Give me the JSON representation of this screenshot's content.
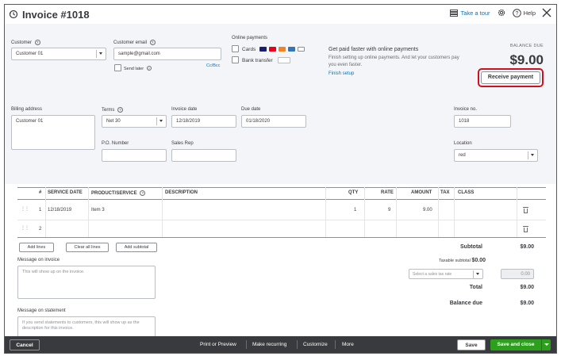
{
  "header": {
    "title": "Invoice #1018",
    "take_tour": "Take a tour",
    "help": "Help"
  },
  "customer": {
    "label": "Customer",
    "value": "Customer 01",
    "email_label": "Customer email",
    "email_value": "sample@gmail.com",
    "send_later": "Send later",
    "cc_bcc": "Cc/Bcc"
  },
  "online_payments": {
    "label": "Online payments",
    "cards": "Cards",
    "bank_transfer": "Bank transfer"
  },
  "promo": {
    "title": "Get paid faster with online payments",
    "body": "Finish setting up online payments. And let your customers pay you even faster.",
    "link": "Finish setup"
  },
  "balance": {
    "label": "BALANCE DUE",
    "amount": "$9.00",
    "receive_payment": "Receive payment"
  },
  "billing": {
    "address_label": "Billing address",
    "address_value": "Customer 01",
    "terms_label": "Terms",
    "terms_value": "Net 30",
    "invoice_date_label": "Invoice date",
    "invoice_date_value": "12/18/2019",
    "due_date_label": "Due date",
    "due_date_value": "01/18/2020",
    "invoice_no_label": "Invoice no.",
    "invoice_no_value": "1018",
    "po_label": "P.O. Number",
    "sales_rep_label": "Sales Rep",
    "location_label": "Location",
    "location_value": "red"
  },
  "table": {
    "headers": {
      "num": "#",
      "service_date": "SERVICE DATE",
      "product": "PRODUCT/SERVICE",
      "description": "DESCRIPTION",
      "qty": "QTY",
      "rate": "RATE",
      "amount": "AMOUNT",
      "tax": "TAX",
      "class": "CLASS"
    },
    "rows": [
      {
        "num": "1",
        "service_date": "12/18/2019",
        "product": "Item 3",
        "description": "",
        "qty": "1",
        "rate": "9",
        "amount": "9.00"
      },
      {
        "num": "2",
        "service_date": "",
        "product": "",
        "description": "",
        "qty": "",
        "rate": "",
        "amount": ""
      }
    ],
    "add_lines": "Add lines",
    "clear_all_lines": "Clear all lines",
    "add_subtotal": "Add subtotal"
  },
  "messages": {
    "invoice_label": "Message on invoice",
    "invoice_placeholder": "This will show up on the invoice.",
    "statement_label": "Message on statement",
    "statement_placeholder": "If you send statements to customers, this will show up as the description for this invoice."
  },
  "totals": {
    "subtotal_label": "Subtotal",
    "subtotal_value": "$9.00",
    "taxable_label": "Taxable subtotal",
    "taxable_value": "$0.00",
    "tax_rate_placeholder": "Select a sales tax rate",
    "tax_value": "0.00",
    "total_label": "Total",
    "total_value": "$9.00",
    "balance_due_label": "Balance due",
    "balance_due_value": "$9.00"
  },
  "footer": {
    "cancel": "Cancel",
    "print_preview": "Print or Preview",
    "make_recurring": "Make recurring",
    "customize": "Customize",
    "more": "More",
    "save": "Save",
    "save_and_close": "Save and close"
  },
  "colors": {
    "accent_green": "#2ca01c",
    "link_blue": "#0077c5",
    "highlight_red": "#d0101f"
  }
}
